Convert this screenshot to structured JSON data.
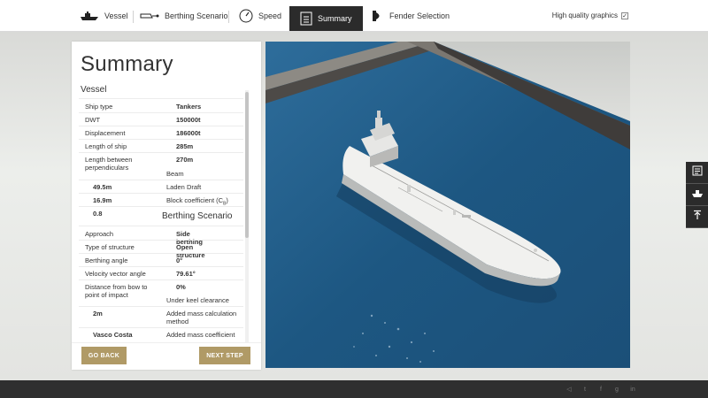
{
  "nav": {
    "steps": [
      {
        "label": "Vessel",
        "icon": "ship-icon"
      },
      {
        "label": "Berthing Scenario",
        "icon": "berthing-icon"
      },
      {
        "label": "Speed",
        "icon": "speedometer-icon"
      },
      {
        "label": "Summary",
        "icon": "list-icon",
        "active": true
      },
      {
        "label": "Fender Selection",
        "icon": "fender-icon"
      }
    ],
    "high_quality": {
      "label": "High quality graphics",
      "checked": true
    }
  },
  "summary": {
    "title": "Summary",
    "vessel_title": "Vessel",
    "berthing_title": "Berthing Scenario",
    "vessel_rows": [
      {
        "key": "Ship type",
        "value": "Tankers"
      },
      {
        "key": "DWT",
        "value": "150000t"
      },
      {
        "key": "Displacement",
        "value": "186000t"
      },
      {
        "key": "Length of ship",
        "value": "285m"
      },
      {
        "key": "Length between perpendiculars",
        "value": "270m"
      }
    ],
    "misaligned": [
      {
        "key": "Beam",
        "value": "49.5m",
        "key2": "Laden Draft"
      },
      {
        "value": "16.9m",
        "key2": "Block coefficient (C",
        "sub": "B",
        "close": ")"
      },
      {
        "value": "0.8"
      }
    ],
    "berthing_rows": [
      {
        "key": "Approach",
        "value": "Side berthing"
      },
      {
        "key": "Type of structure",
        "value": "Open structure"
      },
      {
        "key": "Berthing angle",
        "value": "0°"
      },
      {
        "key": "Velocity vector angle",
        "value": "79.61°"
      },
      {
        "key": "Distance from bow to point of impact",
        "value": "0%"
      }
    ],
    "more": [
      {
        "key2": "Under keel clearance"
      },
      {
        "value": "2m",
        "key2": "Added mass calculation method"
      },
      {
        "value": "Vasco Costa",
        "key2": "Added mass coefficient"
      }
    ]
  },
  "buttons": {
    "back": "GO BACK",
    "next": "NEXT STEP"
  },
  "colors": {
    "accent": "#b09a66",
    "dark": "#2b2b2b",
    "water": "#1f5a86"
  },
  "tools": [
    "notes-icon",
    "ship-dock-icon",
    "upload-icon"
  ],
  "social": [
    "share-icon",
    "twitter-icon",
    "facebook-icon",
    "google-plus-icon",
    "linkedin-icon"
  ]
}
